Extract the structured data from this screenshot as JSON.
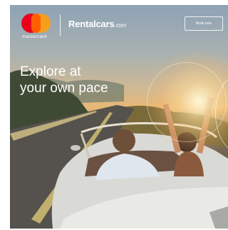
{
  "brand": {
    "mastercard_word": "mastercard",
    "rentalcars_name": "Rentalcars",
    "rentalcars_suffix": ".com"
  },
  "cta": {
    "book_label": "Book now"
  },
  "headline": {
    "line1": "Explore at",
    "line2": "your own pace"
  },
  "colors": {
    "mastercard_red": "#eb001b",
    "mastercard_yellow": "#f79e1b",
    "mastercard_overlap": "#ff5f00",
    "text": "#ffffff"
  },
  "scene": {
    "icons": [
      "mastercard-logo-icon",
      "convertible-car-illustration",
      "sun-flare-icon"
    ]
  }
}
